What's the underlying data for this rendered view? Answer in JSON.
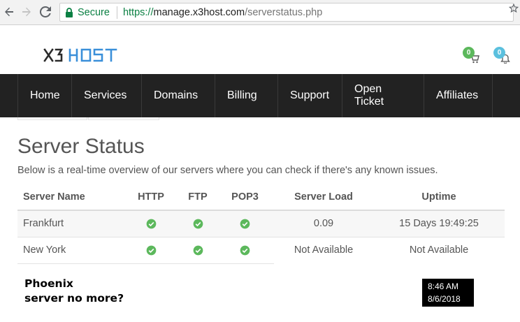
{
  "browser": {
    "secure_label": "Secure",
    "url_scheme": "https://",
    "url_host": "manage.x3host.com",
    "url_path": "/serverstatus.php",
    "icons": [
      "back-arrow-icon",
      "forward-arrow-icon",
      "reload-icon",
      "lock-icon",
      "star-icon"
    ]
  },
  "header": {
    "logo_text": "X3HOST",
    "cart_count": "0",
    "notifications_count": "0"
  },
  "nav": {
    "items": [
      "Home",
      "Services",
      "Domains",
      "Billing",
      "Support",
      "Open Ticket",
      "Affiliates"
    ]
  },
  "page": {
    "title": "Server Status",
    "description": "Below is a real-time overview of our servers where you can check if there's any known issues."
  },
  "table": {
    "headers": [
      "Server Name",
      "HTTP",
      "FTP",
      "POP3",
      "Server Load",
      "Uptime"
    ],
    "rows": [
      {
        "name": "Frankfurt",
        "http": "ok",
        "ftp": "ok",
        "pop3": "ok",
        "load": "0.09",
        "uptime": "15 Days 19:49:25"
      },
      {
        "name": "New York",
        "http": "ok",
        "ftp": "ok",
        "pop3": "ok",
        "load": "Not Available",
        "uptime": "Not Available"
      }
    ]
  },
  "note": {
    "line1": "Phoenix",
    "line2": "server no more?"
  },
  "clock": {
    "time": "8:46 AM",
    "date": "8/6/2018"
  },
  "colors": {
    "nav_bg": "#222222",
    "secure_green": "#0b8043",
    "check_green": "#5cb85c",
    "logo_blue": "#3a8fd9",
    "badge_blue": "#5bc0de"
  }
}
